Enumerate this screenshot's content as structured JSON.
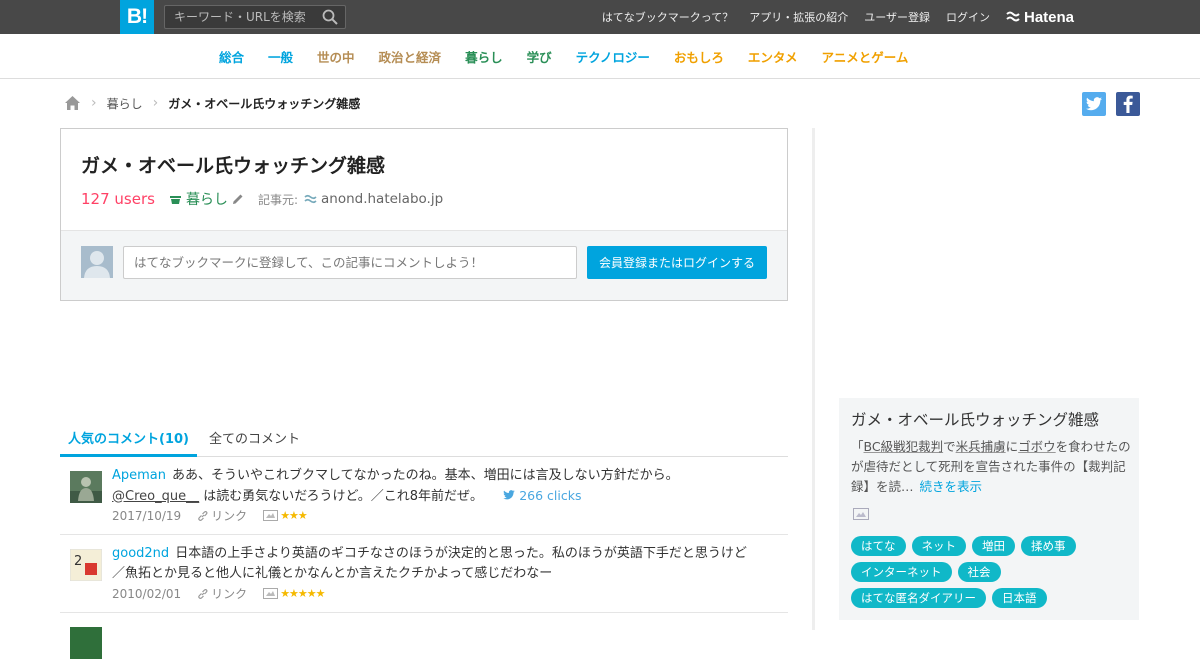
{
  "header": {
    "logo": "B!",
    "search_placeholder": "キーワード・URLを検索",
    "nav": [
      "はてなブックマークって？",
      "アプリ・拡張の紹介",
      "ユーザー登録",
      "ログイン"
    ],
    "hatena": "Hatena"
  },
  "categories": [
    {
      "label": "総合",
      "color": "#00a4de"
    },
    {
      "label": "一般",
      "color": "#00a4de"
    },
    {
      "label": "世の中",
      "color": "#b58d54"
    },
    {
      "label": "政治と経済",
      "color": "#b58d54"
    },
    {
      "label": "暮らし",
      "color": "#2a8f57"
    },
    {
      "label": "学び",
      "color": "#2a8f57"
    },
    {
      "label": "テクノロジー",
      "color": "#00a4de"
    },
    {
      "label": "おもしろ",
      "color": "#f0a000"
    },
    {
      "label": "エンタメ",
      "color": "#f0a000"
    },
    {
      "label": "アニメとゲーム",
      "color": "#f0a000"
    }
  ],
  "breadcrumb": {
    "category": "暮らし",
    "current": "ガメ・オベール氏ウォッチング雑感"
  },
  "entry": {
    "title": "ガメ・オベール氏ウォッチング雑感",
    "users": "127 users",
    "category": "暮らし",
    "source_label": "記事元:",
    "source": "anond.hatelabo.jp",
    "comment_placeholder": "はてなブックマークに登録して、この記事にコメントしよう！",
    "login_button": "会員登録またはログインする"
  },
  "tabs": {
    "popular": "人気のコメント(10)",
    "all": "全てのコメント"
  },
  "comments": [
    {
      "user": "Apeman",
      "text": "ああ、そういやこれブクマしてなかったのね。基本、増田には言及しない方針だから。",
      "mention": "@Creo_que__",
      "text2": "は読む勇気ないだろうけど。／これ8年前だぜ。",
      "clicks": "266 clicks",
      "date": "2017/10/19",
      "link": "リンク",
      "stars": 3
    },
    {
      "user": "good2nd",
      "text": "日本語の上手さより英語のギコチなさのほうが決定的と思った。私のほうが英語下手だと思うけど／魚拓とか見ると他人に礼儀とかなんとか言えたクチかよって感じだわなー",
      "date": "2010/02/01",
      "link": "リンク",
      "stars": 5
    }
  ],
  "sidebar": {
    "title": "ガメ・オベール氏ウォッチング雑感",
    "excerpt_parts": [
      "「",
      "BC級戦犯裁判",
      "で",
      "米兵捕虜",
      "に",
      "ゴボウ",
      "を食わせたのが虐待だとして死刑を宣告された事件の【裁判記録】を読…"
    ],
    "more": "続きを表示",
    "tags": [
      "はてな",
      "ネット",
      "増田",
      "揉め事",
      "インターネット",
      "社会",
      "はてな匿名ダイアリー",
      "日本語"
    ]
  }
}
